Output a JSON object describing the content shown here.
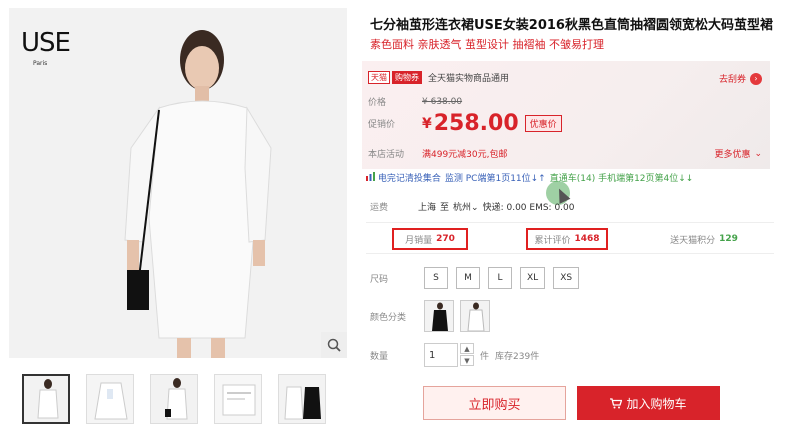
{
  "brand": {
    "logo": "USE",
    "logo_sub": "Paris"
  },
  "product": {
    "title": "七分袖茧形连衣裙USE女装2016秋黑色直筒抽褶圆领宽松大码茧型裙",
    "subtitle": "素色面料 亲肤透气 茧型设计 抽褶袖 不皱易打理"
  },
  "promo": {
    "tmall_tag": "天猫",
    "gouwuquan_tag": "购物券",
    "store_text": "全天猫实物商品通用",
    "coupon_link": "去刮券",
    "price_label": "价格",
    "old_price": "¥ 638.00",
    "promo_label": "促销价",
    "currency": "¥",
    "price": "258.00",
    "discount_badge": "优惠价",
    "activity_label": "本店活动",
    "activity_text": "满499元减30元,包邮",
    "more_link": "更多优惠"
  },
  "ranks": {
    "item1": "电完记清投集合",
    "item2": "监测 PC端第1页11位↓↑",
    "item3": "直通车(14) 手机端第12页第4位↓↓"
  },
  "shipping": {
    "label": "运费",
    "from": "上海",
    "to_word": "至",
    "to": "杭州",
    "express": "快递: 0.00 EMS: 0.00"
  },
  "stats": {
    "monthly_sales_label": "月销量",
    "monthly_sales": "270",
    "reviews_label": "累计评价",
    "reviews": "1468",
    "points_label": "送天猫积分",
    "points": "129"
  },
  "options": {
    "size_label": "尺码",
    "sizes": [
      "S",
      "M",
      "L",
      "XL",
      "XS"
    ],
    "color_label": "颜色分类",
    "qty_label": "数量",
    "qty_value": "1",
    "qty_unit": "件",
    "stock": "库存239件"
  },
  "actions": {
    "buy_now": "立即购买",
    "add_cart": "加入购物车"
  },
  "colors": {
    "accent": "#d8232a",
    "green": "#44a24a",
    "blue": "#3a62b8"
  }
}
